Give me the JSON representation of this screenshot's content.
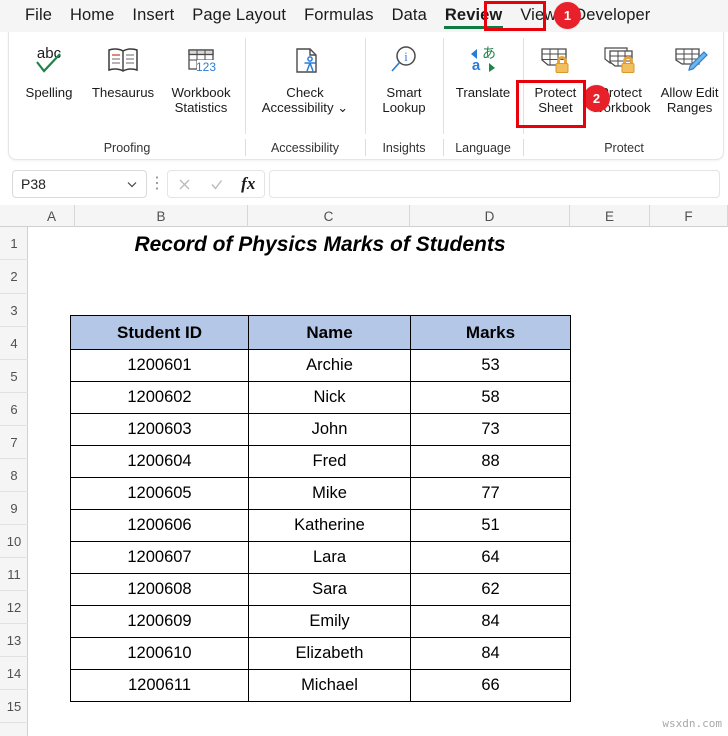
{
  "ribbon": {
    "tabs": [
      {
        "label": "File",
        "active": false
      },
      {
        "label": "Home",
        "active": false
      },
      {
        "label": "Insert",
        "active": false
      },
      {
        "label": "Page Layout",
        "active": false
      },
      {
        "label": "Formulas",
        "active": false
      },
      {
        "label": "Data",
        "active": false
      },
      {
        "label": "Review",
        "active": true
      },
      {
        "label": "View",
        "active": false
      },
      {
        "label": "Developer",
        "active": false
      }
    ],
    "commands": [
      {
        "label": "Spelling",
        "icon": "spelling-abc-check-icon"
      },
      {
        "label": "Thesaurus",
        "icon": "thesaurus-book-icon"
      },
      {
        "label": "Workbook\nStatistics",
        "icon": "workbook-statistics-icon"
      },
      {
        "label": "Check\nAccessibility ⌄",
        "icon": "check-accessibility-icon"
      },
      {
        "label": "Smart\nLookup",
        "icon": "smart-lookup-magnifier-icon"
      },
      {
        "label": "Translate",
        "icon": "translate-icon"
      },
      {
        "label": "Protect\nSheet",
        "icon": "protect-sheet-lock-icon"
      },
      {
        "label": "Protect\nWorkbook",
        "icon": "protect-workbook-lock-icon"
      },
      {
        "label": "Allow Edit\nRanges",
        "icon": "allow-edit-ranges-pencil-icon"
      }
    ],
    "group_labels": [
      "Proofing",
      "Accessibility",
      "Insights",
      "Language",
      "Protect"
    ]
  },
  "annotations": {
    "step1": "1",
    "step2": "2",
    "highlight_color": "#e8000b",
    "badge_color": "#e8202a",
    "active_tab_underline_color": "#107c41"
  },
  "formula_bar": {
    "name_box_value": "P38",
    "name_box_chevron": "chevron-down-icon",
    "cancel_icon": "cancel-x-icon",
    "enter_icon": "enter-check-icon",
    "function_icon": "fx",
    "formula_value": ""
  },
  "sheet": {
    "column_headers": [
      "A",
      "B",
      "C",
      "D",
      "E",
      "F"
    ],
    "row_headers": [
      "1",
      "2",
      "3",
      "4",
      "5",
      "6",
      "7",
      "8",
      "9",
      "10",
      "11",
      "12",
      "13",
      "14",
      "15"
    ],
    "title": "Record of Physics Marks of Students",
    "table": {
      "headers": [
        "Student ID",
        "Name",
        "Marks"
      ],
      "header_fill": "#b4c7e7",
      "rows": [
        [
          "1200601",
          "Archie",
          "53"
        ],
        [
          "1200602",
          "Nick",
          "58"
        ],
        [
          "1200603",
          "John",
          "73"
        ],
        [
          "1200604",
          "Fred",
          "88"
        ],
        [
          "1200605",
          "Mike",
          "77"
        ],
        [
          "1200606",
          "Katherine",
          "51"
        ],
        [
          "1200607",
          "Lara",
          "64"
        ],
        [
          "1200608",
          "Sara",
          "62"
        ],
        [
          "1200609",
          "Emily",
          "84"
        ],
        [
          "1200610",
          "Elizabeth",
          "84"
        ],
        [
          "1200611",
          "Michael",
          "66"
        ]
      ]
    }
  },
  "watermark": "wsxdn.com"
}
